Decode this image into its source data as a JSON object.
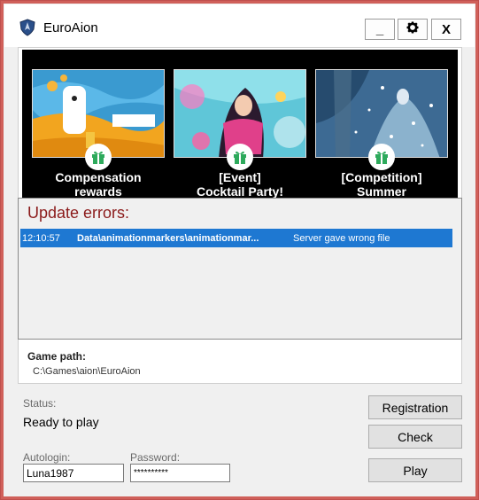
{
  "window": {
    "title": "EuroAion",
    "minimize_label": "_",
    "settings_icon": "gear-icon",
    "close_label": "X"
  },
  "news": [
    {
      "title_line1": "Compensation",
      "title_line2": "rewards",
      "icon": "gift-icon"
    },
    {
      "title_line1": "[Event]",
      "title_line2": "Cocktail Party!",
      "icon": "gift-icon"
    },
    {
      "title_line1": "[Competition]",
      "title_line2": "Summer",
      "icon": "gift-icon"
    }
  ],
  "update_errors": {
    "title": "Update errors:",
    "rows": [
      {
        "time": "12:10:57",
        "file": "Data\\animationmarkers\\animationmar...",
        "message": "Server gave wrong file"
      }
    ]
  },
  "game_path": {
    "label": "Game path:",
    "value": "C:\\Games\\aion\\EuroAion"
  },
  "status": {
    "label": "Status:",
    "value": "Ready to play"
  },
  "login": {
    "autologin_label": "Autologin:",
    "autologin_value": "Luna1987",
    "password_label": "Password:",
    "password_value": "**********"
  },
  "buttons": {
    "registration": "Registration",
    "check": "Check",
    "play": "Play"
  },
  "colors": {
    "accent_border": "#c0504d",
    "error_title": "#8b1a1a",
    "selected_row": "#1e78d2"
  }
}
